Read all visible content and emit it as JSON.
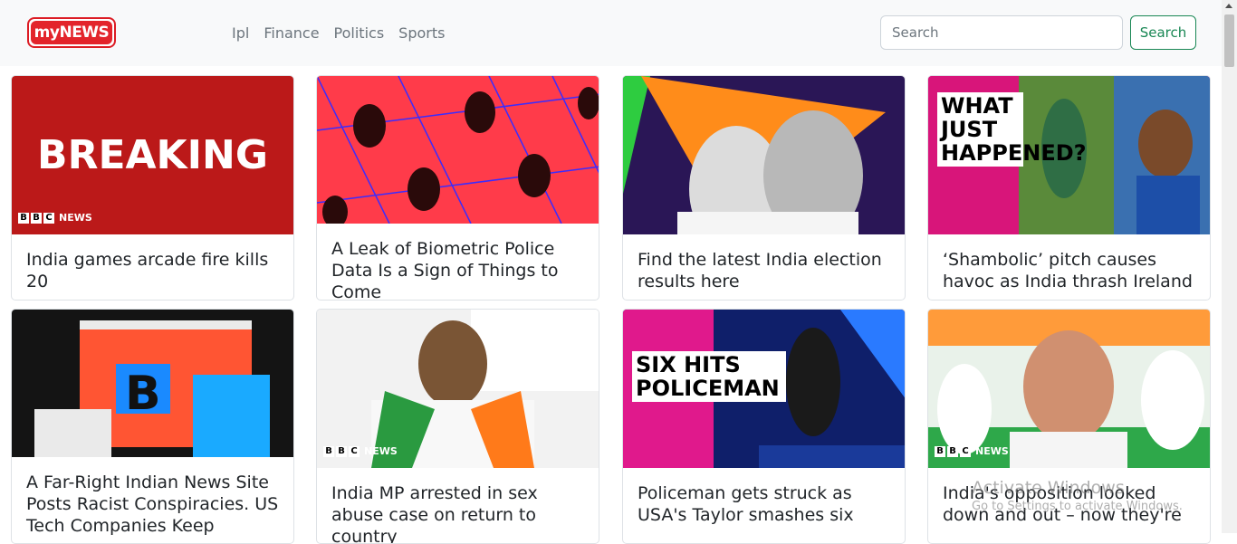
{
  "brand": {
    "logo_text": "myNEWS"
  },
  "nav": {
    "items": [
      "Ipl",
      "Finance",
      "Politics",
      "Sports"
    ]
  },
  "search": {
    "placeholder": "Search",
    "button_label": "Search"
  },
  "cards": [
    {
      "title": "India games arcade fire kills 20",
      "image_text": "BREAKING",
      "badge": "NEWS"
    },
    {
      "title": "A Leak of Biometric Police Data Is a Sign of Things to Come"
    },
    {
      "title": "Find the latest India election results here"
    },
    {
      "title": "‘Shambolic’ pitch causes havoc as India thrash Ireland",
      "image_text": "WHAT JUST HAPPENED?"
    },
    {
      "title": "A Far-Right Indian News Site Posts Racist Conspiracies. US Tech Companies Keep"
    },
    {
      "title": "India MP arrested in sex abuse case on return to country",
      "badge": "NEWS"
    },
    {
      "title": "Policeman gets struck as USA's Taylor smashes six",
      "image_text": "SIX HITS POLICEMAN"
    },
    {
      "title": "India's opposition looked down and out – now they're",
      "badge": "NEWS"
    }
  ],
  "overlay": {
    "line1": "Activate Windows",
    "line2": "Go to Settings to activate Windows."
  },
  "colors": {
    "brand_red": "#e3242b",
    "success_green": "#198754",
    "nav_bg": "#f8f9fa"
  }
}
